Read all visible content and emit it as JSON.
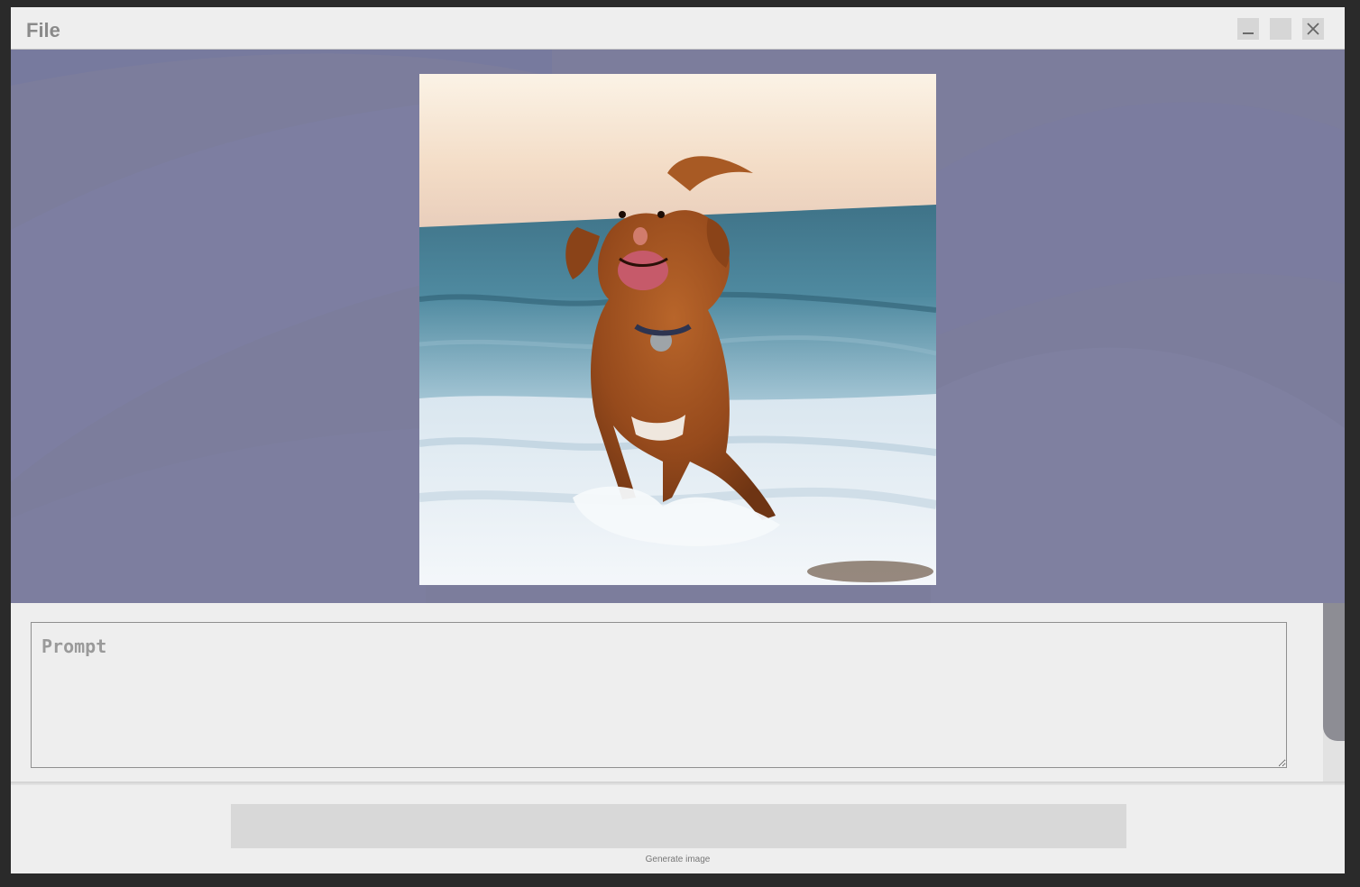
{
  "titlebar": {
    "menu_file": "File",
    "minimize_icon": "minimize-icon",
    "maximize_icon": "maximize-icon",
    "close_icon": "close-icon"
  },
  "canvas": {
    "background_color": "#7c7d9c",
    "image_subject": "dog-running-on-beach-photo"
  },
  "prompt": {
    "placeholder": "Prompt",
    "value": ""
  },
  "footer": {
    "generate_label": "Generate image",
    "button_color": "#d8d8d8"
  }
}
